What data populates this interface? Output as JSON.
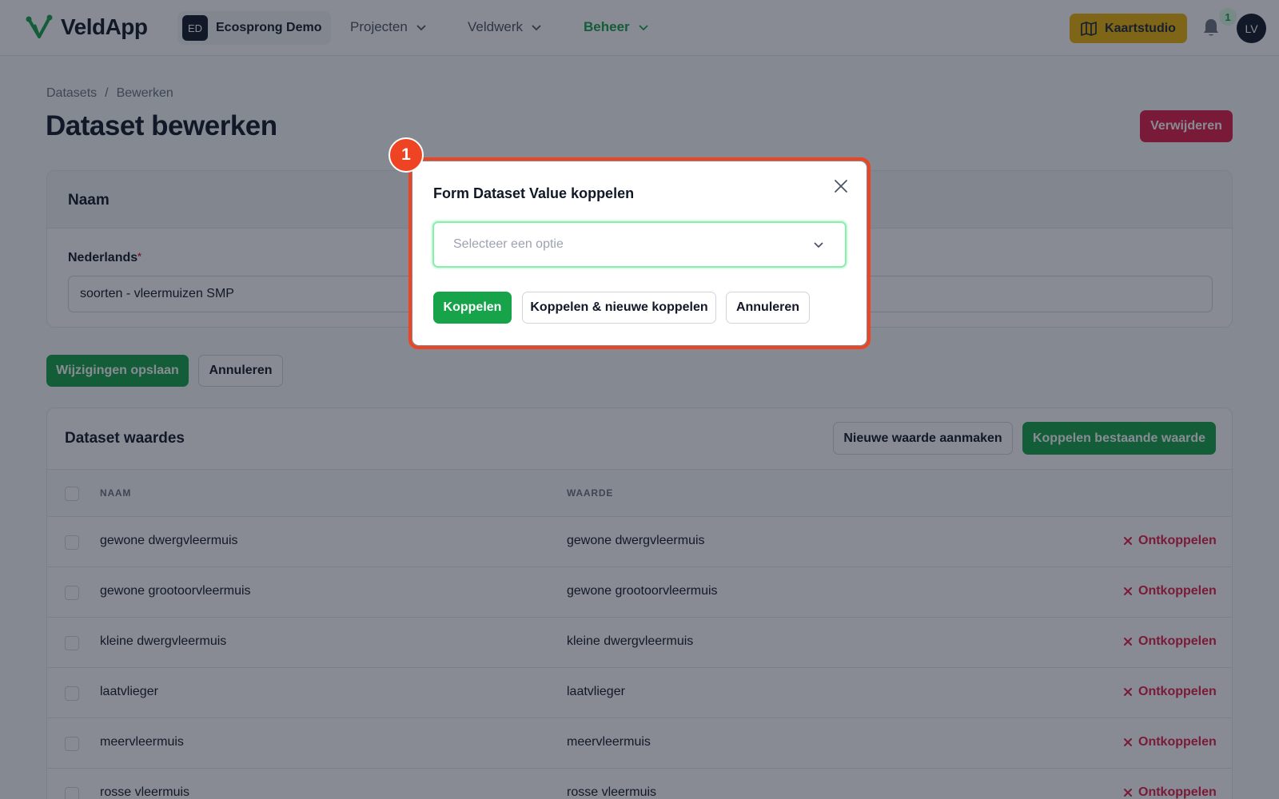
{
  "nav": {
    "app_name": "VeldApp",
    "tenant_initials": "ED",
    "tenant_name": "Ecosprong Demo",
    "menu": [
      {
        "label": "Projecten",
        "active": false
      },
      {
        "label": "Veldwerk",
        "active": false
      },
      {
        "label": "Beheer",
        "active": true
      }
    ],
    "kaartstudio_label": "Kaartstudio",
    "notification_count": "1",
    "user_initials": "LV"
  },
  "colors": {
    "brand_green": "#16a34a",
    "danger": "#e11d48",
    "accent_yellow": "#eab308",
    "highlight": "#ef4423"
  },
  "breadcrumb": [
    "Datasets",
    "Bewerken"
  ],
  "page": {
    "title": "Dataset bewerken",
    "delete_label": "Verwijderen"
  },
  "name_section": {
    "heading": "Naam",
    "field_label": "Nederlands",
    "required_mark": "*",
    "field_value": "soorten - vleermuizen SMP"
  },
  "form_actions": {
    "save_label": "Wijzigingen opslaan",
    "cancel_label": "Annuleren"
  },
  "values_section": {
    "heading": "Dataset waardes",
    "new_value_label": "Nieuwe waarde aanmaken",
    "link_existing_label": "Koppelen bestaande waarde",
    "columns": [
      "NAAM",
      "WAARDE"
    ],
    "unlink_label": "Ontkoppelen",
    "rows": [
      {
        "naam": "gewone dwergvleermuis",
        "waarde": "gewone dwergvleermuis"
      },
      {
        "naam": "gewone grootoorvleermuis",
        "waarde": "gewone grootoorvleermuis"
      },
      {
        "naam": "kleine dwergvleermuis",
        "waarde": "kleine dwergvleermuis"
      },
      {
        "naam": "laatvlieger",
        "waarde": "laatvlieger"
      },
      {
        "naam": "meervleermuis",
        "waarde": "meervleermuis"
      },
      {
        "naam": "rosse vleermuis",
        "waarde": "rosse vleermuis"
      }
    ]
  },
  "modal": {
    "step_number": "1",
    "title": "Form Dataset Value koppelen",
    "select_placeholder": "Selecteer een optie",
    "primary_label": "Koppelen",
    "secondary_label": "Koppelen & nieuwe koppelen",
    "cancel_label": "Annuleren"
  }
}
